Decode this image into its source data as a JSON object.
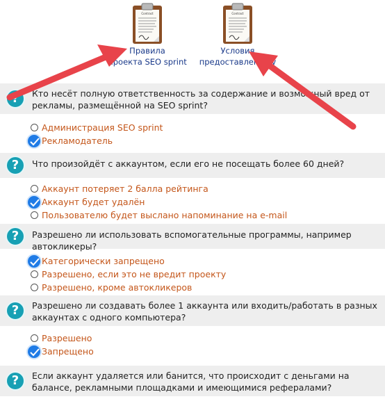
{
  "docs": [
    {
      "label_line1": "Правила",
      "label_line2": "проекта SEO sprint",
      "icon": "clipboard-document-icon",
      "clip_title": "Contract"
    },
    {
      "label_line1": "Условия",
      "label_line2": "предоставления у",
      "icon": "clipboard-document-icon",
      "clip_title": "Contract"
    }
  ],
  "questions": [
    {
      "text": "Кто несёт полную ответственность за содержание и возможный вред от рекламы, размещённой на SEO sprint?",
      "options": [
        {
          "label": "Администрация SEO sprint",
          "selected": false
        },
        {
          "label": "Рекламодатель",
          "selected": true
        }
      ]
    },
    {
      "text": "Что произойдёт с аккаунтом, если его не посещать более 60 дней?",
      "options": [
        {
          "label": "Аккаунт потеряет 2 балла рейтинга",
          "selected": false
        },
        {
          "label": "Аккаунт будет удалён",
          "selected": true
        },
        {
          "label": "Пользователю будет выслано напоминание на e-mail",
          "selected": false
        }
      ]
    },
    {
      "text": "Разрешено ли использовать вспомогательные программы, например автокликеры?",
      "options": [
        {
          "label": "Категорически запрещено",
          "selected": true
        },
        {
          "label": "Разрешено, если это не вредит проекту",
          "selected": false
        },
        {
          "label": "Разрешено, кроме автокликеров",
          "selected": false
        }
      ]
    },
    {
      "text": "Разрешено ли создавать более 1 аккаунта или входить/работать в разных аккаунтах с одного компьютера?",
      "options": [
        {
          "label": "Разрешено",
          "selected": false
        },
        {
          "label": "Запрещено",
          "selected": true
        }
      ]
    },
    {
      "text": "Если аккаунт удаляется или банится, что происходит с деньгами на балансе, рекламными площадками и имеющимися рефералами?",
      "options": []
    }
  ],
  "colors": {
    "question_icon": "#17a0b4",
    "option_text": "#c4561a",
    "check": "#1f7be6",
    "arrow": "#e8434a",
    "header_bg": "#eeeeee"
  }
}
